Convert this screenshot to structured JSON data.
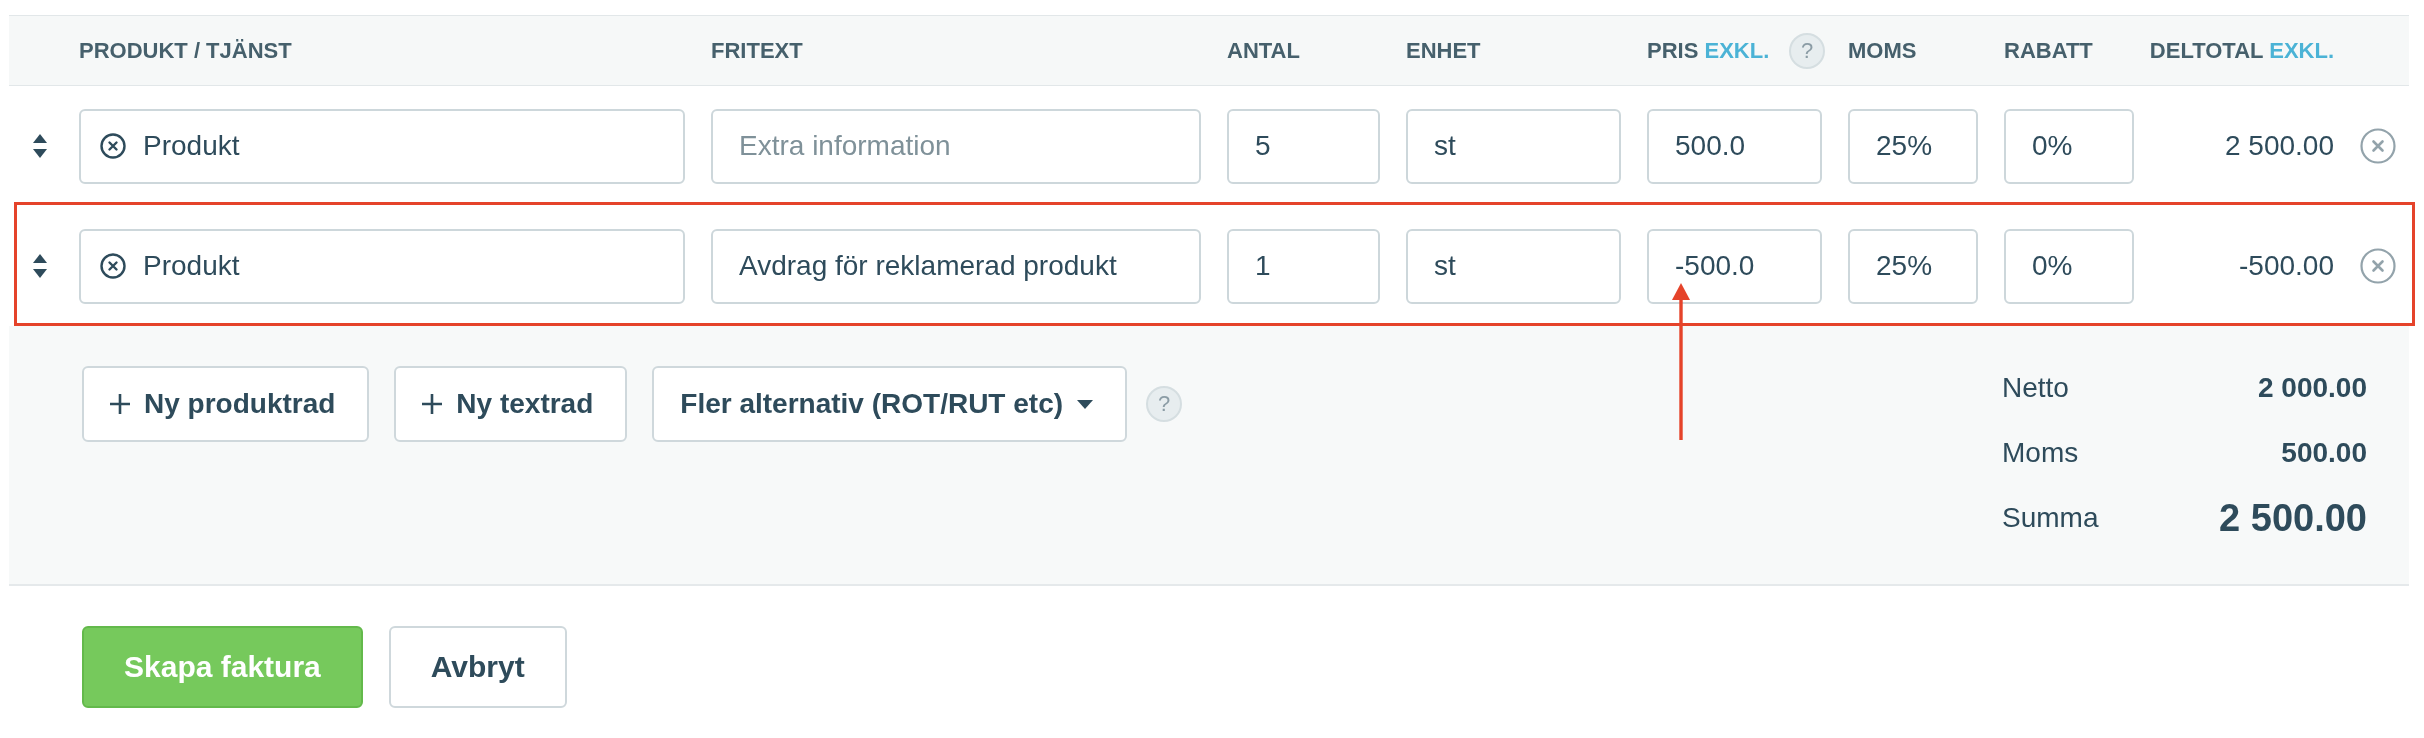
{
  "columns": [
    {
      "label": "PRODUKT / TJÄNST"
    },
    {
      "label": "FRITEXT"
    },
    {
      "label": "ANTAL"
    },
    {
      "label": "ENHET"
    },
    {
      "label": "PRIS",
      "suffix": "EXKL.",
      "help": "?"
    },
    {
      "label": "MOMS"
    },
    {
      "label": "RABATT"
    },
    {
      "label": "DELTOTAL",
      "suffix": "EXKL."
    }
  ],
  "rows": [
    {
      "product": "Produkt",
      "description": {
        "placeholder": "Extra information"
      },
      "quantity": "5",
      "unit": "st",
      "price": "500.0",
      "vat": "25%",
      "discount": "0%",
      "subtotal": "2 500.00",
      "highlighted": false,
      "price_arrow": false
    },
    {
      "product": "Produkt",
      "description": {
        "value": "Avdrag för reklamerad produkt"
      },
      "quantity": "1",
      "unit": "st",
      "price": "-500.0",
      "vat": "25%",
      "discount": "0%",
      "subtotal": "-500.00",
      "highlighted": true,
      "price_arrow": true
    }
  ],
  "actions": [
    {
      "kind": "add",
      "label": "Ny produktrad"
    },
    {
      "kind": "add",
      "label": "Ny textrad"
    },
    {
      "kind": "dropdown",
      "label": "Fler alternativ (ROT/RUT etc)"
    }
  ],
  "actions_help": "?",
  "totals": [
    {
      "kind": "line",
      "label": "Netto",
      "value": "2 000.00"
    },
    {
      "kind": "line",
      "label": "Moms",
      "value": "500.00"
    },
    {
      "kind": "total",
      "label": "Summa",
      "value": "2 500.00"
    }
  ],
  "buttons": [
    {
      "kind": "primary",
      "label": "Skapa faktura"
    },
    {
      "kind": "secondary",
      "label": "Avbryt"
    }
  ]
}
